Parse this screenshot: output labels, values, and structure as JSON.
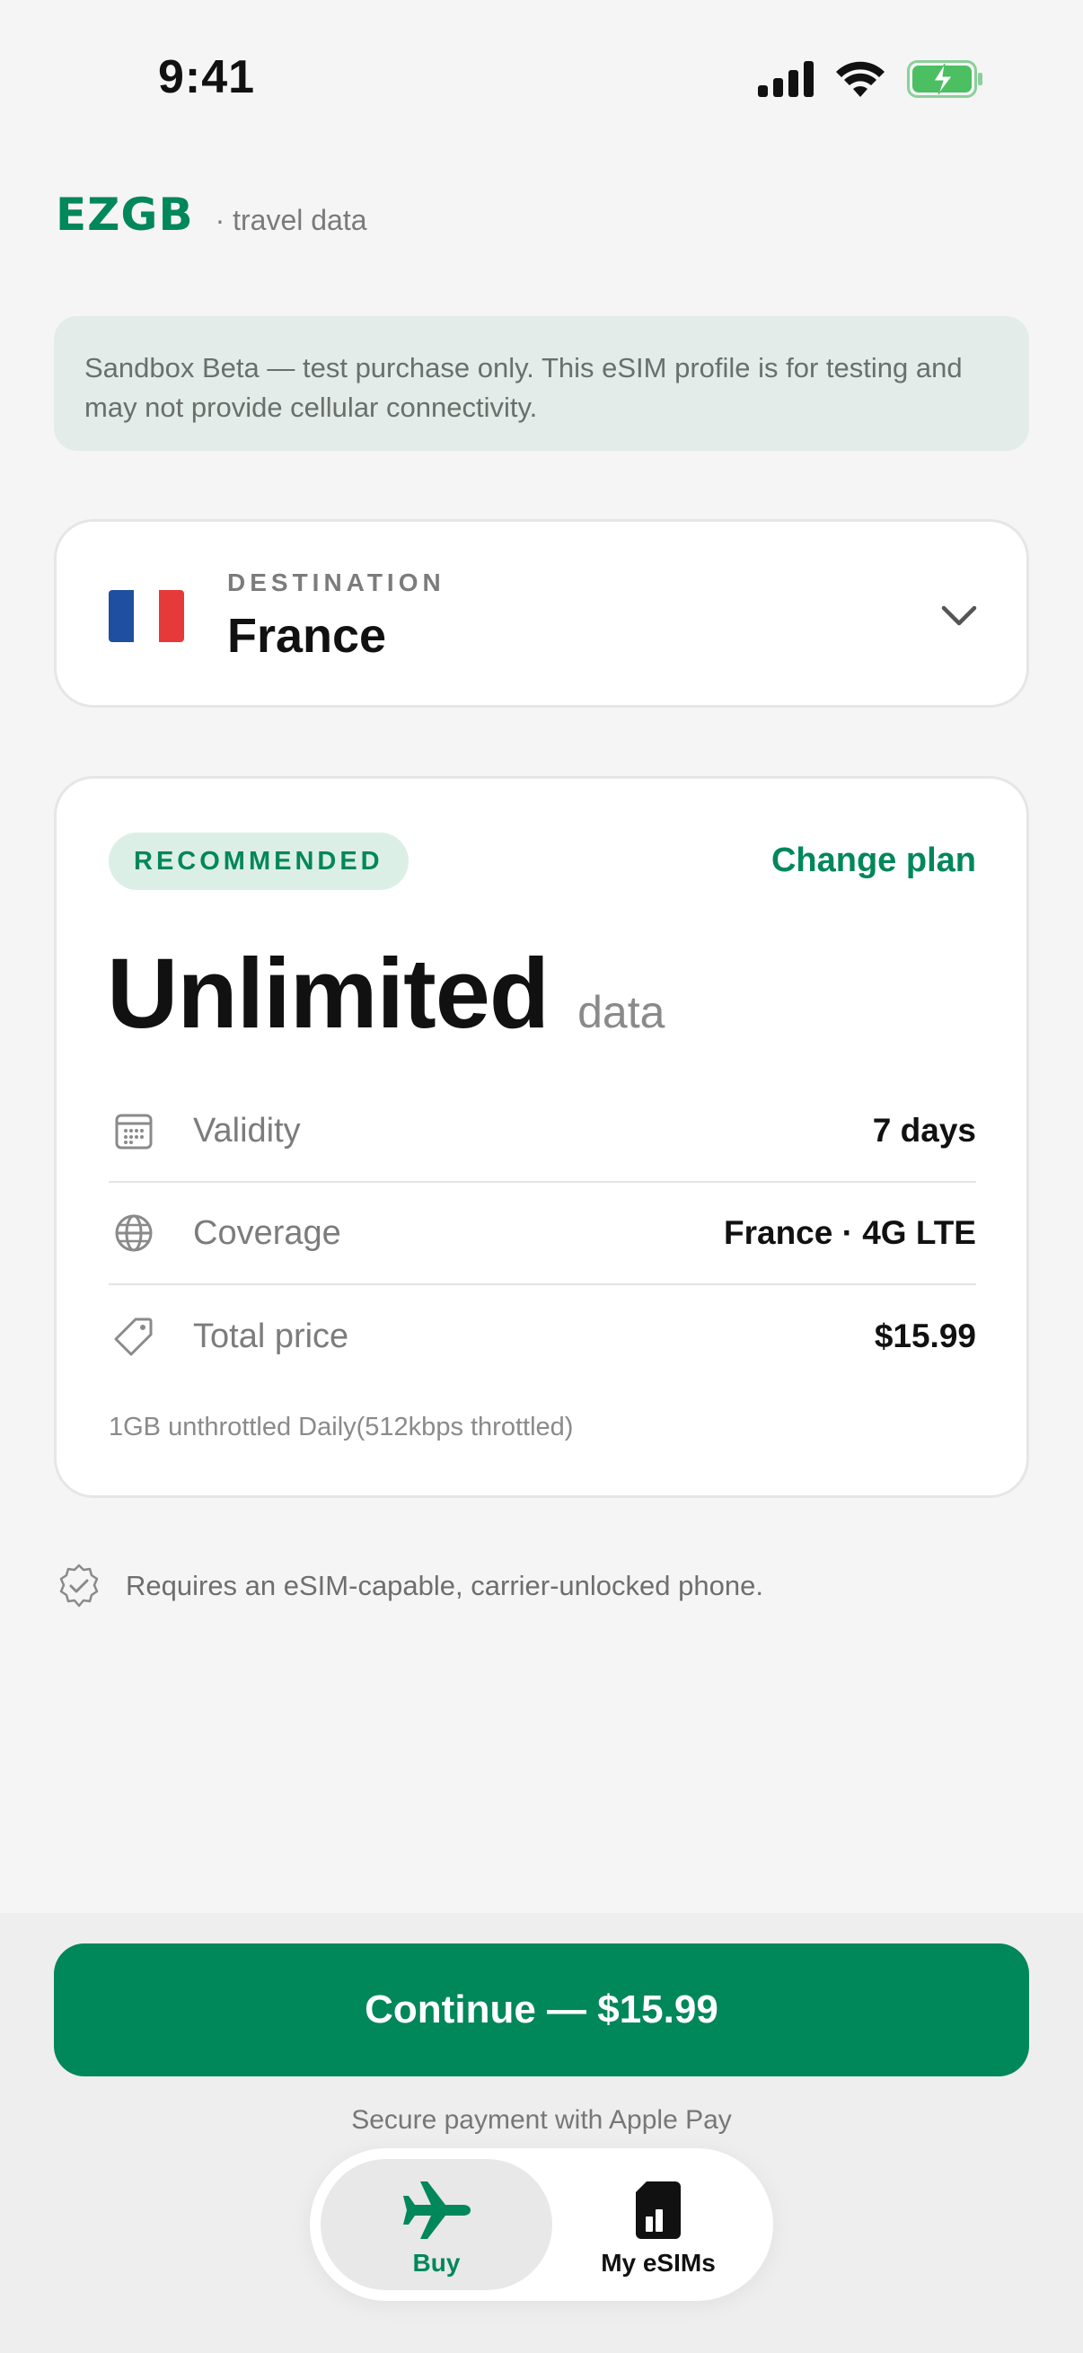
{
  "status_bar": {
    "time": "9:41"
  },
  "brand": {
    "logo": "EZGB",
    "subtitle": "· travel data"
  },
  "notice": {
    "text": "Sandbox Beta — test purchase only. This eSIM profile is for testing and may not provide cellular connectivity."
  },
  "destination": {
    "label": "DESTINATION",
    "value": "France",
    "flag_colors": [
      "#1f4fa0",
      "#ffffff",
      "#e63a3a"
    ]
  },
  "plan": {
    "badge": "RECOMMENDED",
    "change_label": "Change plan",
    "name": "Unlimited",
    "unit": "data",
    "rows": [
      {
        "icon": "calendar-icon",
        "label": "Validity",
        "value": "7 days"
      },
      {
        "icon": "globe-icon",
        "label": "Coverage",
        "value": "France · 4G LTE"
      },
      {
        "icon": "price-tag-icon",
        "label": "Total price",
        "value": "$15.99"
      }
    ],
    "note": "1GB unthrottled Daily(512kbps throttled)"
  },
  "requirement": {
    "icon": "verified-badge-icon",
    "text": "Requires an eSIM-capable, carrier-unlocked phone."
  },
  "checkout": {
    "button_label": "Continue — $15.99",
    "secure_text": "Secure payment with Apple Pay"
  },
  "tabs": [
    {
      "label": "Buy",
      "icon": "airplane-icon",
      "active": true
    },
    {
      "label": "My eSIMs",
      "icon": "sim-card-icon",
      "active": false
    }
  ],
  "colors": {
    "accent": "#00875a",
    "notice_bg": "#e3ece8",
    "badge_bg": "#dcefe6",
    "background": "#f5f5f5"
  }
}
